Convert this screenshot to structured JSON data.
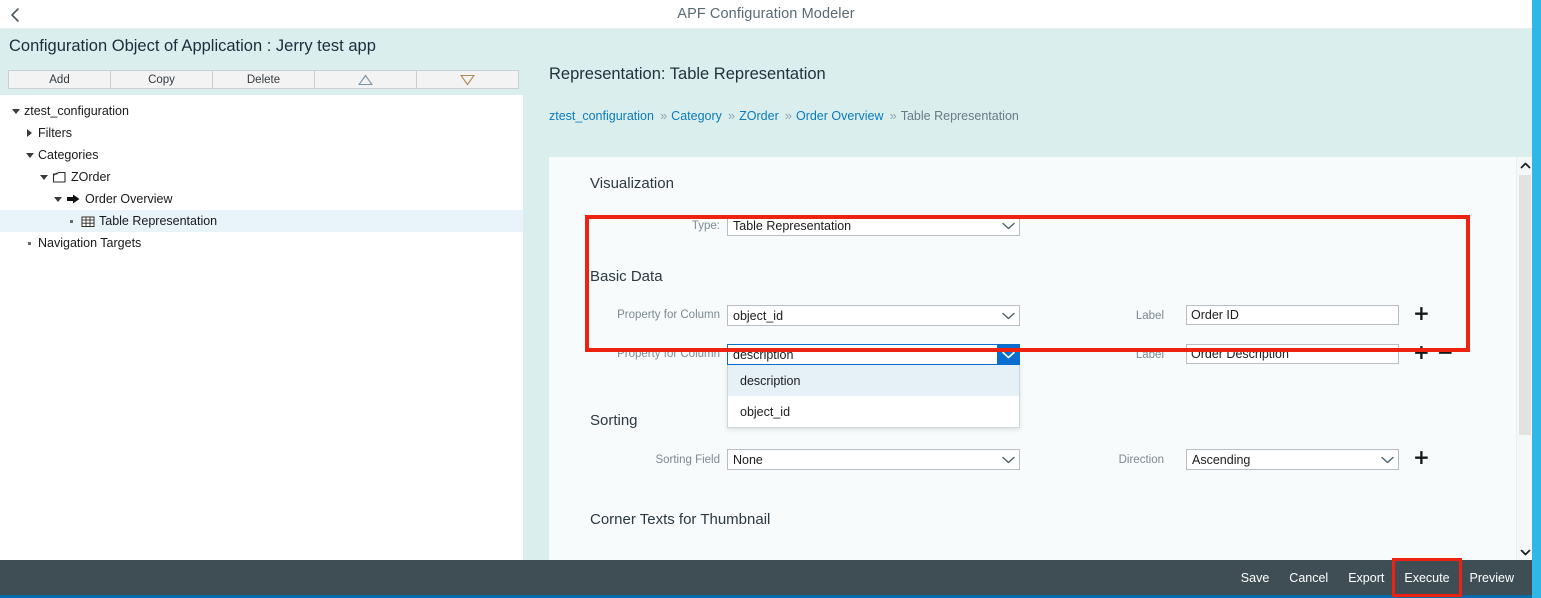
{
  "shell": {
    "title": "APF Configuration Modeler",
    "back_icon": "chevron-left-icon"
  },
  "left_panel": {
    "heading": "Configuration Object of Application : Jerry test app",
    "toolbar": [
      {
        "label": "Add",
        "name": "add-button"
      },
      {
        "label": "Copy",
        "name": "copy-button"
      },
      {
        "label": "Delete",
        "name": "delete-button"
      },
      {
        "label": "",
        "name": "move-up-button",
        "icon": "triangle-up-icon"
      },
      {
        "label": "",
        "name": "move-down-button",
        "icon": "triangle-down-icon"
      }
    ],
    "tree": [
      {
        "label": "ztest_configuration",
        "indent": 0,
        "twisty": "caret-down",
        "icon": "",
        "selected": false
      },
      {
        "label": "Filters",
        "indent": 1,
        "twisty": "caret-right",
        "icon": "",
        "selected": false
      },
      {
        "label": "Categories",
        "indent": 1,
        "twisty": "caret-down",
        "icon": "",
        "selected": false
      },
      {
        "label": "ZOrder",
        "indent": 2,
        "twisty": "caret-down",
        "icon": "category-icon",
        "selected": false
      },
      {
        "label": "Order Overview",
        "indent": 3,
        "twisty": "caret-down",
        "icon": "step-icon",
        "selected": false
      },
      {
        "label": "Table Representation",
        "indent": 4,
        "twisty": "dot",
        "icon": "table-icon",
        "selected": true
      },
      {
        "label": "Navigation Targets",
        "indent": 1,
        "twisty": "dot",
        "icon": "",
        "selected": false
      }
    ]
  },
  "right_panel": {
    "title": "Representation: Table Representation",
    "breadcrumb": [
      {
        "label": "ztest_configuration",
        "link": true
      },
      {
        "label": "Category",
        "link": true
      },
      {
        "label": "ZOrder",
        "link": true
      },
      {
        "label": "Order Overview",
        "link": true
      },
      {
        "label": "Table Representation",
        "link": false
      }
    ],
    "breadcrumb_separator": "»",
    "sections": {
      "visualization": {
        "title": "Visualization",
        "type_label": "Type:",
        "type_value": "Table Representation"
      },
      "basic_data": {
        "title": "Basic Data",
        "rows": [
          {
            "property_label": "Property for Column",
            "property_value": "object_id",
            "label_label": "Label",
            "label_value": "Order ID",
            "add": "+",
            "remove": ""
          },
          {
            "property_label": "Property for Column",
            "property_value": "description",
            "label_label": "Label",
            "label_value": "Order Description",
            "add": "+",
            "remove": "−"
          }
        ],
        "open_dropdown": {
          "options": [
            "description",
            "object_id"
          ],
          "highlighted": "description"
        }
      },
      "sorting": {
        "title": "Sorting",
        "field_label": "Sorting Field",
        "field_value": "None",
        "direction_label": "Direction",
        "direction_value": "Ascending",
        "add": "+"
      },
      "corner_texts": {
        "title": "Corner Texts for Thumbnail"
      }
    },
    "scrollbar": {
      "up_icon": "chevron-up-icon",
      "down_icon": "chevron-down-icon"
    }
  },
  "footer": {
    "buttons": [
      {
        "label": "Save",
        "name": "save-button",
        "highlighted": false
      },
      {
        "label": "Cancel",
        "name": "cancel-button",
        "highlighted": false
      },
      {
        "label": "Export",
        "name": "export-button",
        "highlighted": false
      },
      {
        "label": "Execute",
        "name": "execute-button",
        "highlighted": true
      },
      {
        "label": "Preview",
        "name": "preview-button",
        "highlighted": false
      }
    ]
  },
  "colors": {
    "accent_blue": "#0a6ed1",
    "link_blue": "#0a7bbd",
    "panel_teal": "#dbeeee",
    "footer_dark": "#3f4e55",
    "annotation_red": "#ee2211",
    "edge_cyan": "#2fb7e8"
  }
}
